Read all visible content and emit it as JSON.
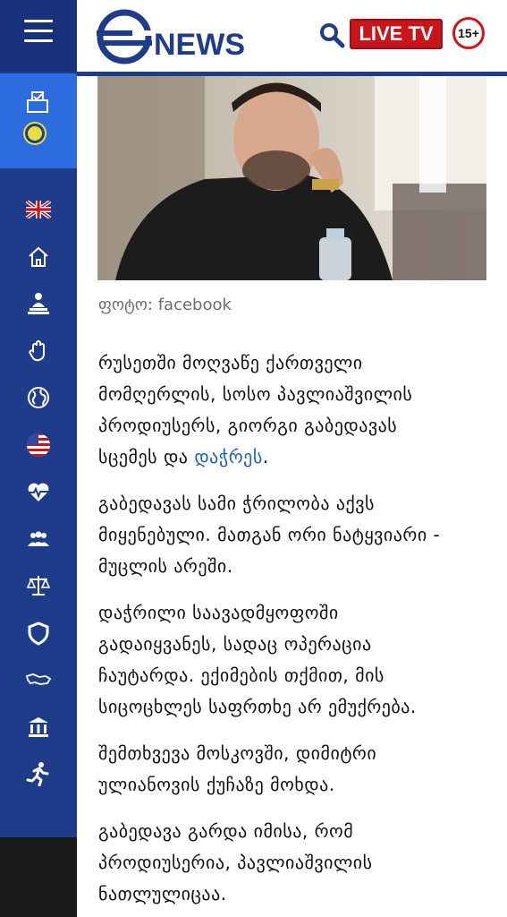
{
  "header": {
    "logo_text": "NEWS",
    "live_label": "LIVE TV",
    "age_rating": "15+"
  },
  "sidebar": {
    "icons": [
      "flag-uk-icon",
      "home-icon",
      "person-podium-icon",
      "hand-icon",
      "globe-icon",
      "flag-us-icon",
      "heart-pulse-icon",
      "people-icon",
      "scales-icon",
      "shield-icon",
      "georgia-map-icon",
      "bank-icon",
      "runner-icon"
    ]
  },
  "photo": {
    "caption": "ფოტო: facebook"
  },
  "article": {
    "p1": {
      "l1": "რუსეთში მოღვაწე ქართველი",
      "l2": "მომღერლის, სოსო პავლიაშვილის",
      "l3": "პროდიუსერს, გიორგი გაბედავას",
      "l4_pre": "სცემეს და ",
      "l4_link": "დაჭრეს",
      "l4_post": "."
    },
    "p2": {
      "l1": "გაბედავას სამი ჭრილობა აქვს",
      "l2": "მიყენებული. მათგან ორი ნატყვიარი -",
      "l3": "მუცლის არეში."
    },
    "p3": {
      "l1": "დაჭრილი საავადმყოფოში",
      "l2": "გადაიყვანეს, სადაც ოპერაცია",
      "l3": "ჩაუტარდა. ექიმების თქმით, მის",
      "l4": "სიცოცხლეს საფრთხე არ ემუქრება."
    },
    "p4": {
      "l1": "შემთხვევა მოსკოვში, დიმიტრი",
      "l2": "ულიანოვის ქუჩაზე მოხდა."
    },
    "p5": {
      "l1": "გაბედავა გარდა იმისა, რომ",
      "l2": "პროდიუსერია, პავლიაშვილის",
      "l3": "ნათლულიცაა."
    }
  },
  "colors": {
    "brand_blue": "#1f3c8a",
    "sidebar_active": "#2d6cdf",
    "live_red": "#c8151b",
    "link_blue": "#1a5fb4"
  }
}
